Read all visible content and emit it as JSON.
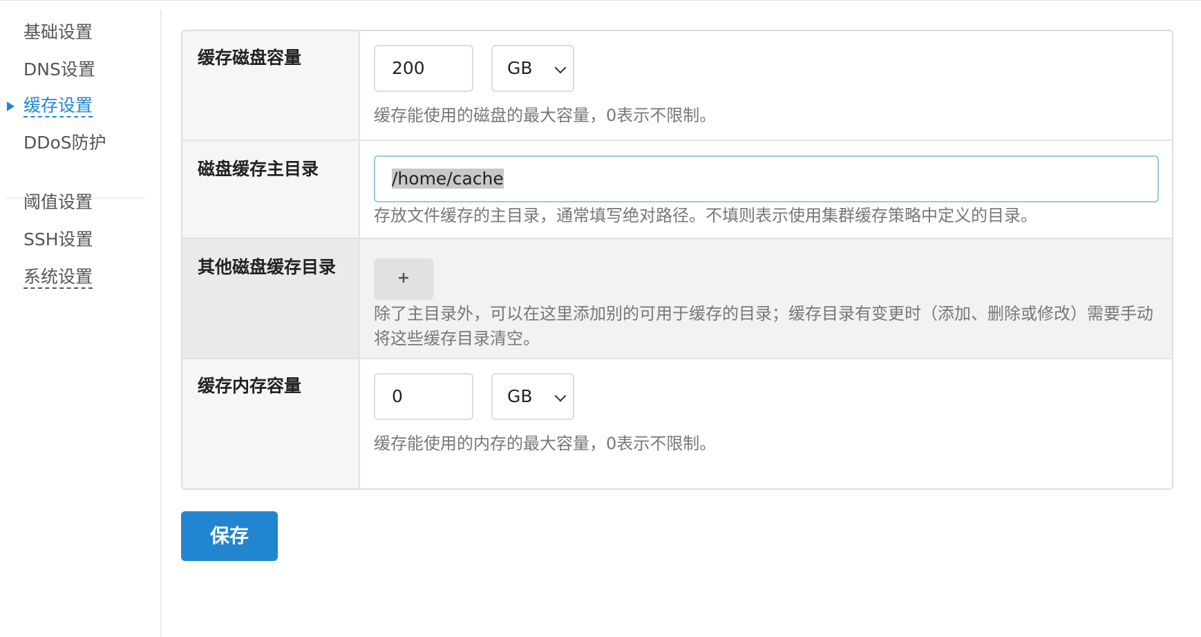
{
  "sidebar": {
    "items": [
      {
        "label": "基础设置"
      },
      {
        "label": "DNS设置"
      },
      {
        "label": "缓存设置"
      },
      {
        "label": "DDoS防护"
      },
      {
        "label": "阈值设置"
      },
      {
        "label": "SSH设置"
      },
      {
        "label": "系统设置"
      }
    ],
    "active_index": 2
  },
  "form": {
    "disk_capacity": {
      "label": "缓存磁盘容量",
      "value": "200",
      "unit": "GB",
      "help": "缓存能使用的磁盘的最大容量，0表示不限制。"
    },
    "main_dir": {
      "label": "磁盘缓存主目录",
      "value": "/home/cache",
      "help": "存放文件缓存的主目录，通常填写绝对路径。不填则表示使用集群缓存策略中定义的目录。"
    },
    "other_dirs": {
      "label": "其他磁盘缓存目录",
      "add_label": "+",
      "help": "除了主目录外，可以在这里添加别的可用于缓存的目录；缓存目录有变更时（添加、删除或修改）需要手动将这些缓存目录清空。"
    },
    "memory_capacity": {
      "label": "缓存内存容量",
      "value": "0",
      "unit": "GB",
      "help": "缓存能使用的内存的最大容量，0表示不限制。"
    }
  },
  "actions": {
    "save_label": "保存"
  },
  "colors": {
    "accent": "#2185d0"
  }
}
